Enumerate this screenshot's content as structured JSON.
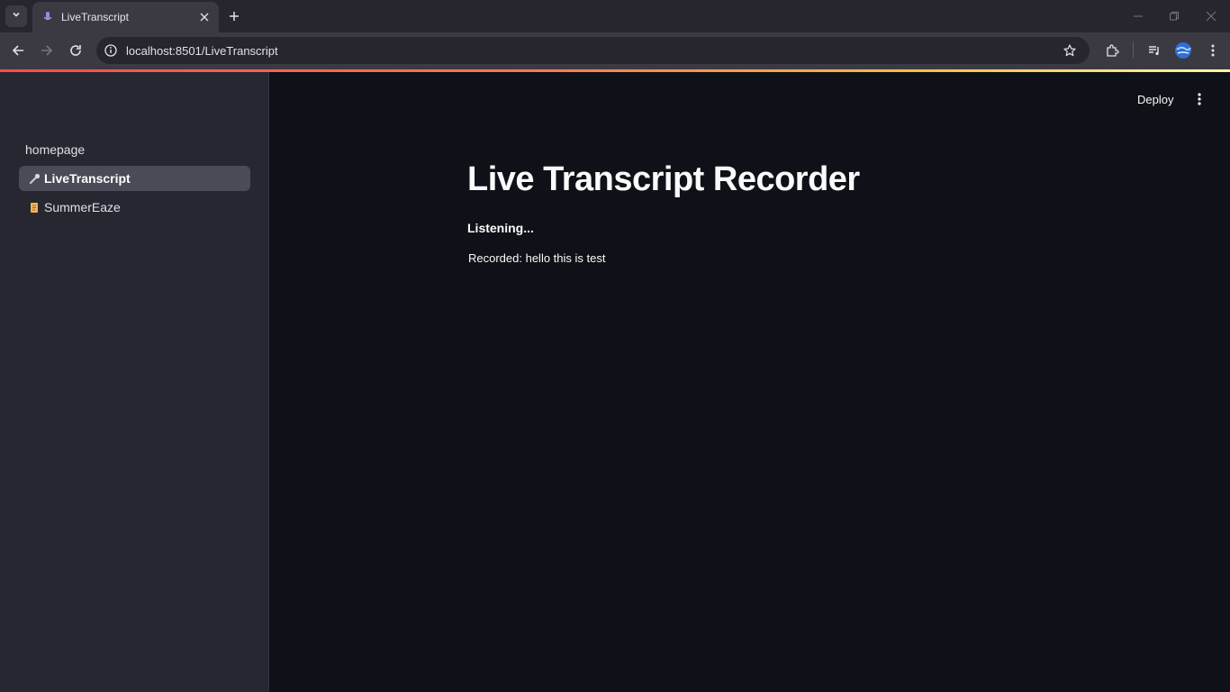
{
  "browser": {
    "tab_title": "LiveTranscript",
    "url": "localhost:8501/LiveTranscript",
    "icons": {
      "tab_list": "chevron-down-icon",
      "close_tab": "close-icon",
      "new_tab": "plus-icon",
      "back": "arrow-left-icon",
      "forward": "arrow-right-icon",
      "reload": "reload-icon",
      "site_info": "info-icon",
      "bookmark": "star-icon",
      "extensions": "puzzle-icon",
      "media": "media-queue-icon",
      "profile": "avatar",
      "menu": "kebab-icon"
    }
  },
  "sidebar": {
    "items": [
      {
        "label": "homepage",
        "icon": ""
      },
      {
        "label": "LiveTranscript",
        "icon": "microphone-icon",
        "active": true
      },
      {
        "label": "SummerEaze",
        "icon": "scroll-icon"
      }
    ]
  },
  "header": {
    "deploy_label": "Deploy",
    "menu_icon": "kebab-icon"
  },
  "main": {
    "title": "Live Transcript Recorder",
    "status": "Listening...",
    "recorded_text": "Recorded: hello this is test"
  },
  "colors": {
    "app_background": "#0e1117",
    "sidebar_background": "#262730",
    "active_nav": "#4a4b57",
    "text": "#fafafa"
  }
}
